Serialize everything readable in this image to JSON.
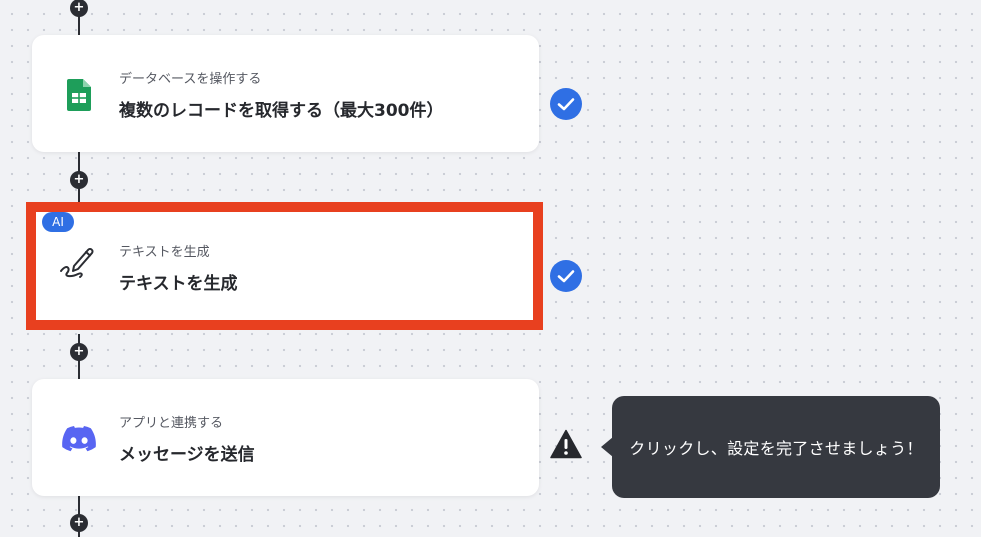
{
  "colors": {
    "accent": "#2f6fe4",
    "highlight_border": "#e8401f",
    "tooltip_bg": "#363940",
    "discord": "#5865f2",
    "sheets": "#1e9e5a"
  },
  "add_step_symbol": "+",
  "steps": [
    {
      "icon": "google-sheets-icon",
      "subtitle": "データベースを操作する",
      "title": "複数のレコードを取得する（最大300件）",
      "status": "check-icon"
    },
    {
      "icon": "pen-icon",
      "badge": "AI",
      "subtitle": "テキストを生成",
      "title": "テキストを生成",
      "status": "check-icon"
    },
    {
      "icon": "discord-icon",
      "subtitle": "アプリと連携する",
      "title": "メッセージを送信",
      "status": "warning-icon"
    }
  ],
  "tooltip": {
    "text": "クリックし、設定を完了させましょう！"
  }
}
